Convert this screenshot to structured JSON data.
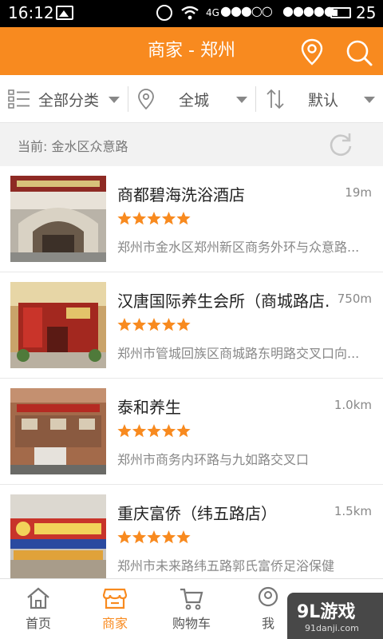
{
  "status_bar": {
    "time": "16:12",
    "network": "4G",
    "battery": "25"
  },
  "header": {
    "title": "商家 - 郑州",
    "color": "#f88a1f"
  },
  "filters": {
    "category": "全部分类",
    "area": "全城",
    "sort": "默认"
  },
  "current_location": {
    "text": "当前: 金水区众意路"
  },
  "merchants": [
    {
      "name": "商都碧海洗浴酒店",
      "distance": "19m",
      "rating": 5,
      "address": "郑州市金水区郑州新区商务外环与众意路..."
    },
    {
      "name": "汉唐国际养生会所（商城路店...",
      "distance": "750m",
      "rating": 5,
      "address": "郑州市管城回族区商城路东明路交叉口向..."
    },
    {
      "name": "泰和养生",
      "distance": "1.0km",
      "rating": 5,
      "address": "郑州市商务内环路与九如路交叉口"
    },
    {
      "name": "重庆富侨（纬五路店）",
      "distance": "1.5km",
      "rating": 5,
      "address": "郑州市未来路纬五路郭氏富侨足浴保健"
    }
  ],
  "tabbar": {
    "tabs": [
      {
        "label": "首页",
        "icon": "home-icon"
      },
      {
        "label": "商家",
        "icon": "store-icon",
        "active": true
      },
      {
        "label": "购物车",
        "icon": "cart-icon"
      },
      {
        "label": "我",
        "icon": "profile-icon"
      }
    ]
  },
  "watermark": {
    "brand": "9L游戏",
    "site": "91danji.com"
  }
}
